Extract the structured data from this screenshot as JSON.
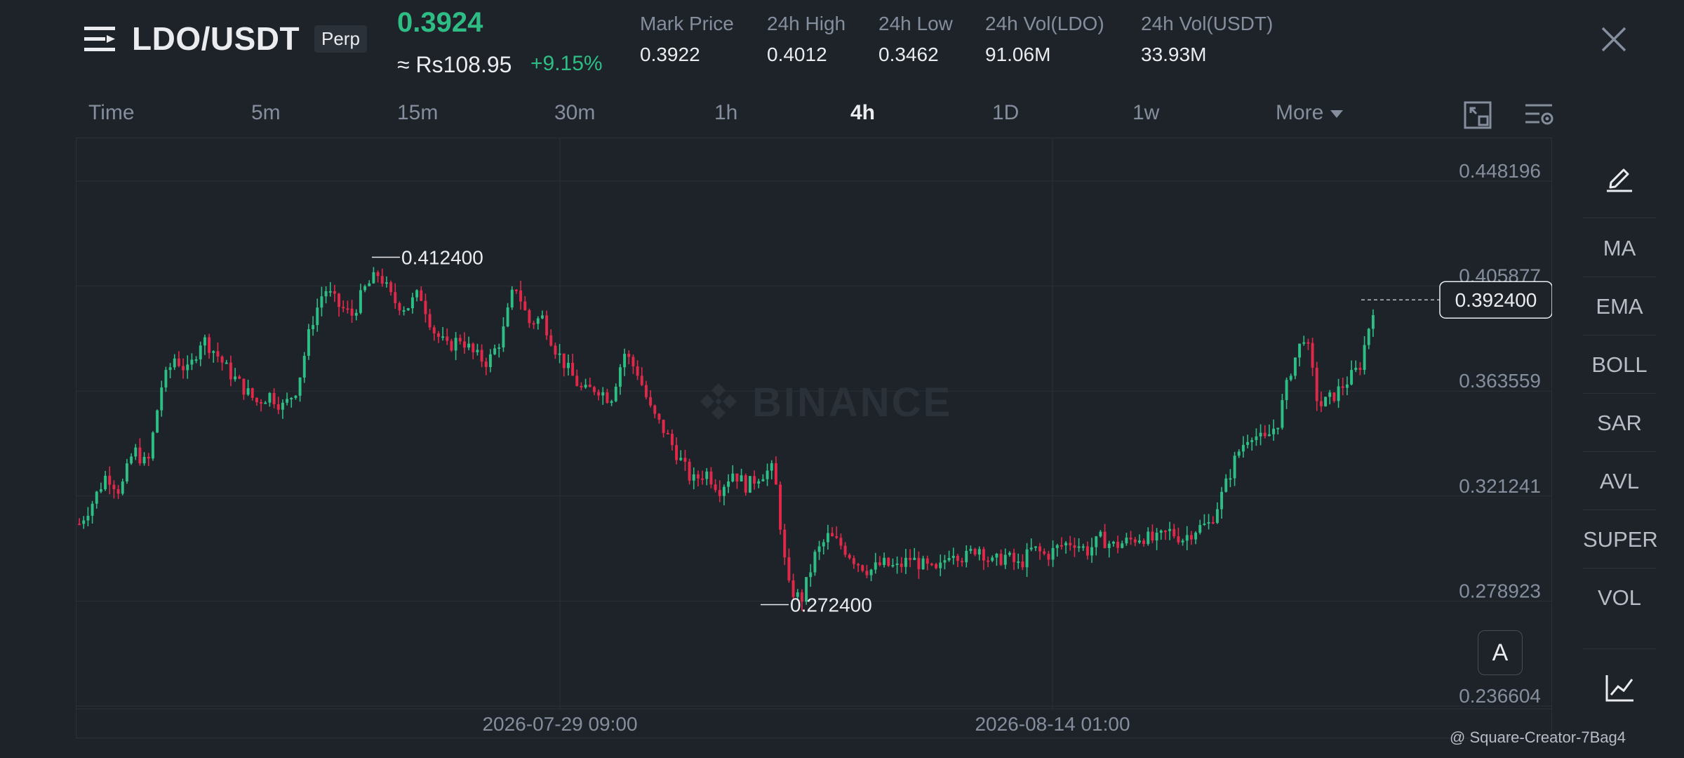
{
  "header": {
    "pair": "LDO/USDT",
    "badge": "Perp",
    "last_price": "0.3924",
    "local_price": "≈ Rs108.95",
    "change": "+9.15%",
    "stats": [
      {
        "label": "Mark Price",
        "value": "0.3922"
      },
      {
        "label": "24h High",
        "value": "0.4012"
      },
      {
        "label": "24h Low",
        "value": "0.3462"
      },
      {
        "label": "24h Vol(LDO)",
        "value": "91.06M"
      },
      {
        "label": "24h Vol(USDT)",
        "value": "33.93M"
      }
    ]
  },
  "timeframes": [
    "Time",
    "5m",
    "15m",
    "30m",
    "1h",
    "4h",
    "1D",
    "1w",
    "More"
  ],
  "active_timeframe": "4h",
  "indicators": [
    "MA",
    "EMA",
    "BOLL",
    "SAR",
    "AVL",
    "SUPER",
    "VOL"
  ],
  "auto_button": "A",
  "watermark": "BINANCE",
  "footer": "@ Square-Creator-7Bag4",
  "colors": {
    "up": "#2ebd85",
    "down": "#e0294a",
    "bg": "#1e2329",
    "grid": "#2b3139"
  },
  "chart_data": {
    "type": "candlestick",
    "ylim": [
      0.236604,
      0.448196
    ],
    "y_ticks": [
      "0.448196",
      "0.405877",
      "0.363559",
      "0.321241",
      "0.278923",
      "0.236604"
    ],
    "x_ticks": [
      "2026-07-29 09:00",
      "2026-08-14 01:00"
    ],
    "high_annotation": "0.412400",
    "low_annotation": "0.272400",
    "current_price_label": "0.392400",
    "close_path": [
      [
        0,
        0.305
      ],
      [
        4,
        0.314
      ],
      [
        8,
        0.325
      ],
      [
        12,
        0.318
      ],
      [
        16,
        0.335
      ],
      [
        20,
        0.328
      ],
      [
        24,
        0.36
      ],
      [
        28,
        0.372
      ],
      [
        32,
        0.366
      ],
      [
        36,
        0.38
      ],
      [
        40,
        0.374
      ],
      [
        44,
        0.366
      ],
      [
        48,
        0.36
      ],
      [
        52,
        0.354
      ],
      [
        56,
        0.357
      ],
      [
        60,
        0.352
      ],
      [
        64,
        0.36
      ],
      [
        68,
        0.385
      ],
      [
        72,
        0.4
      ],
      [
        76,
        0.393
      ],
      [
        80,
        0.389
      ],
      [
        84,
        0.4
      ],
      [
        88,
        0.406
      ],
      [
        92,
        0.395
      ],
      [
        96,
        0.392
      ],
      [
        100,
        0.398
      ],
      [
        104,
        0.383
      ],
      [
        108,
        0.376
      ],
      [
        112,
        0.38
      ],
      [
        116,
        0.373
      ],
      [
        120,
        0.37
      ],
      [
        124,
        0.38
      ],
      [
        128,
        0.402
      ],
      [
        132,
        0.386
      ],
      [
        136,
        0.388
      ],
      [
        140,
        0.375
      ],
      [
        144,
        0.366
      ],
      [
        148,
        0.358
      ],
      [
        152,
        0.36
      ],
      [
        156,
        0.355
      ],
      [
        160,
        0.374
      ],
      [
        164,
        0.366
      ],
      [
        168,
        0.35
      ],
      [
        172,
        0.342
      ],
      [
        176,
        0.332
      ],
      [
        180,
        0.322
      ],
      [
        184,
        0.326
      ],
      [
        188,
        0.319
      ],
      [
        192,
        0.326
      ],
      [
        196,
        0.32
      ],
      [
        200,
        0.325
      ],
      [
        204,
        0.327
      ],
      [
        208,
        0.28
      ],
      [
        212,
        0.274
      ],
      [
        216,
        0.292
      ],
      [
        220,
        0.3
      ],
      [
        224,
        0.296
      ],
      [
        228,
        0.29
      ],
      [
        232,
        0.286
      ],
      [
        236,
        0.289
      ],
      [
        240,
        0.287
      ],
      [
        244,
        0.291
      ],
      [
        248,
        0.288
      ],
      [
        252,
        0.285
      ],
      [
        256,
        0.295
      ],
      [
        260,
        0.291
      ],
      [
        264,
        0.296
      ],
      [
        268,
        0.289
      ],
      [
        272,
        0.292
      ],
      [
        276,
        0.288
      ],
      [
        280,
        0.295
      ],
      [
        284,
        0.292
      ],
      [
        288,
        0.296
      ],
      [
        292,
        0.298
      ],
      [
        296,
        0.294
      ],
      [
        300,
        0.299
      ],
      [
        304,
        0.296
      ],
      [
        308,
        0.298
      ],
      [
        312,
        0.3
      ],
      [
        316,
        0.298
      ],
      [
        320,
        0.302
      ],
      [
        324,
        0.299
      ],
      [
        328,
        0.303
      ],
      [
        332,
        0.305
      ],
      [
        336,
        0.318
      ],
      [
        340,
        0.333
      ],
      [
        344,
        0.342
      ],
      [
        348,
        0.338
      ],
      [
        352,
        0.346
      ],
      [
        356,
        0.368
      ],
      [
        360,
        0.382
      ],
      [
        364,
        0.352
      ],
      [
        368,
        0.356
      ],
      [
        372,
        0.362
      ],
      [
        376,
        0.368
      ],
      [
        380,
        0.392
      ]
    ]
  }
}
